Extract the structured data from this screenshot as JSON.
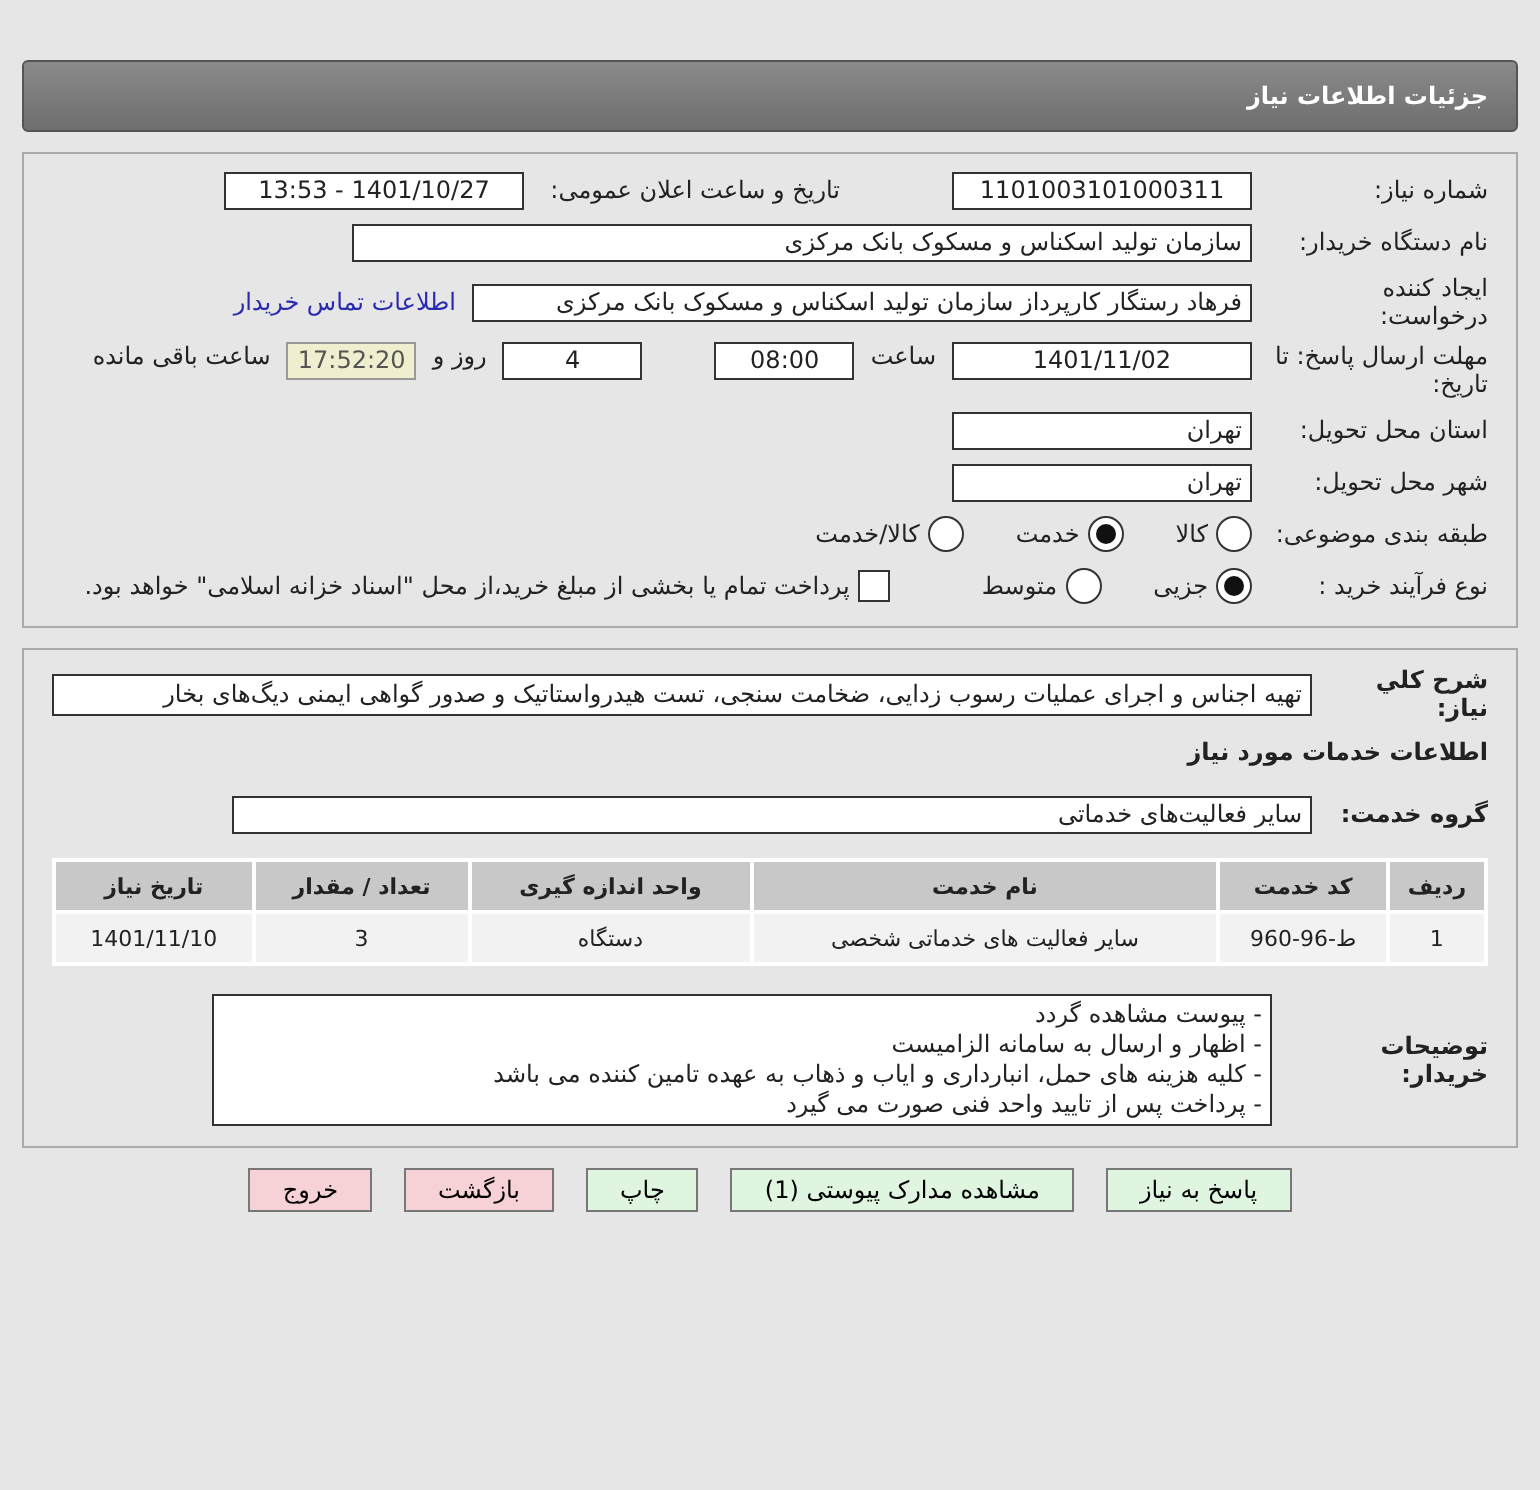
{
  "header": {
    "title": "جزئیات اطلاعات نیاز"
  },
  "details": {
    "need_number": {
      "label": "شماره نیاز:",
      "value": "1101003101000311"
    },
    "announce": {
      "label": "تاریخ و ساعت اعلان عمومی:",
      "value": "1401/10/27 - 13:53"
    },
    "buyer": {
      "label": "نام دستگاه خریدار:",
      "value": "سازمان تولید اسکناس و مسکوک بانک مرکزی"
    },
    "requester": {
      "label": "ایجاد کننده درخواست:",
      "value": "فرهاد رستگار کارپرداز سازمان تولید اسکناس و مسکوک بانک مرکزی",
      "link": "اطلاعات تماس خریدار"
    },
    "deadline": {
      "label": "مهلت ارسال پاسخ: تا تاریخ:",
      "date": "1401/11/02",
      "time_label": "ساعت",
      "time": "08:00",
      "days": "4",
      "days_label": "روز و",
      "remaining": "17:52:20",
      "remaining_label": "ساعت باقی مانده"
    },
    "province": {
      "label": "استان محل تحویل:",
      "value": "تهران"
    },
    "city": {
      "label": "شهر محل تحویل:",
      "value": "تهران"
    },
    "category": {
      "label": "طبقه بندی موضوعی:",
      "options": [
        {
          "label": "کالا",
          "selected": false
        },
        {
          "label": "خدمت",
          "selected": true
        },
        {
          "label": "کالا/خدمت",
          "selected": false
        }
      ]
    },
    "purchase_type": {
      "label": "نوع فرآیند خرید :",
      "options": [
        {
          "label": "جزیی",
          "selected": true
        },
        {
          "label": "متوسط",
          "selected": false
        }
      ],
      "treasury": {
        "label": "پرداخت تمام یا بخشی از مبلغ خرید،از محل \"اسناد خزانه اسلامی\" خواهد بود.",
        "checked": false
      }
    }
  },
  "summary": {
    "label": "شرح کلي نياز:",
    "value": "تهیه اجناس و اجرای عملیات رسوب زدایی، ضخامت سنجی، تست هیدرواستاتیک و صدور گواهی ایمنی دیگ‌های بخار"
  },
  "services_heading": "اطلاعات خدمات مورد نیاز",
  "service_group": {
    "label": "گروه خدمت:",
    "value": "سایر فعالیت‌های خدماتی"
  },
  "table": {
    "columns": [
      "ردیف",
      "کد خدمت",
      "نام خدمت",
      "واحد اندازه گیری",
      "تعداد / مقدار",
      "تاریخ نیاز"
    ],
    "rows": [
      [
        "1",
        "ط-96-960",
        "سایر فعالیت های خدماتی شخصی",
        "دستگاه",
        "3",
        "1401/11/10"
      ]
    ]
  },
  "notes": {
    "label": "توضیحات خریدار:",
    "lines": [
      "- پیوست مشاهده گردد",
      "- اظهار و ارسال به سامانه الزامیست",
      "- کلیه هزینه های حمل، انبارداری و ایاب و ذهاب به عهده تامین کننده می باشد",
      "- پرداخت پس از تایید واحد فنی صورت می گیرد"
    ]
  },
  "buttons": [
    {
      "label": "پاسخ به نیاز",
      "kind": "green"
    },
    {
      "label": "مشاهده مدارک پیوستی (1)",
      "kind": "green"
    },
    {
      "label": "چاپ",
      "kind": "green"
    },
    {
      "label": "بازگشت",
      "kind": "pink"
    },
    {
      "label": "خروج",
      "kind": "pink"
    }
  ]
}
